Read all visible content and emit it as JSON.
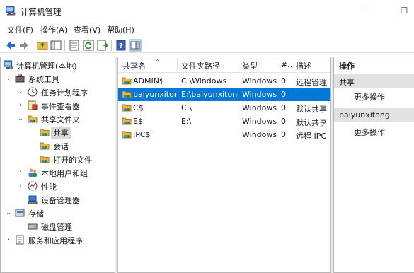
{
  "window": {
    "title": "计算机管理",
    "minimize_glyph": "—",
    "maximize_glyph": "☐"
  },
  "menu": [
    "文件(F)",
    "操作(A)",
    "查看(V)",
    "帮助(H)"
  ],
  "toolbar": {
    "icons": [
      "back-arrow-icon",
      "forward-arrow-icon",
      "up-folder-icon",
      "show-hide-tree-icon",
      "properties-icon",
      "refresh-icon",
      "export-list-icon",
      "help-icon",
      "show-action-pane-icon"
    ]
  },
  "tree": {
    "root": "计算机管理(本地)",
    "system_tools": "系统工具",
    "task_scheduler": "任务计划程序",
    "event_viewer": "事件查看器",
    "shared_folders": "共享文件夹",
    "shares": "共享",
    "sessions": "会话",
    "open_files": "打开的文件",
    "local_users": "本地用户和组",
    "performance": "性能",
    "device_manager": "设备管理器",
    "storage": "存储",
    "disk_management": "磁盘管理",
    "services_apps": "服务和应用程序"
  },
  "list": {
    "columns": [
      "共享名",
      "文件夹路径",
      "类型",
      "#..",
      "描述"
    ],
    "rows": [
      {
        "name": "ADMIN$",
        "path": "C:\\Windows",
        "type": "Windows",
        "count": "0",
        "desc": "远程管理"
      },
      {
        "name": "baiyunxitong",
        "path": "E:\\baiyunxitong",
        "type": "Windows",
        "count": "0",
        "desc": ""
      },
      {
        "name": "C$",
        "path": "C:\\",
        "type": "Windows",
        "count": "0",
        "desc": "默认共享"
      },
      {
        "name": "E$",
        "path": "E:\\",
        "type": "Windows",
        "count": "0",
        "desc": "默认共享"
      },
      {
        "name": "IPC$",
        "path": "",
        "type": "Windows",
        "count": "0",
        "desc": "远程 IPC"
      }
    ],
    "selected_index": 1
  },
  "actions": {
    "header": "操作",
    "section1": "共享",
    "section1_more": "更多操作",
    "section2": "baiyunxitong",
    "section2_more": "更多操作"
  },
  "colors": {
    "selection": "#0078d7",
    "section_bg": "#e1e1e1"
  }
}
